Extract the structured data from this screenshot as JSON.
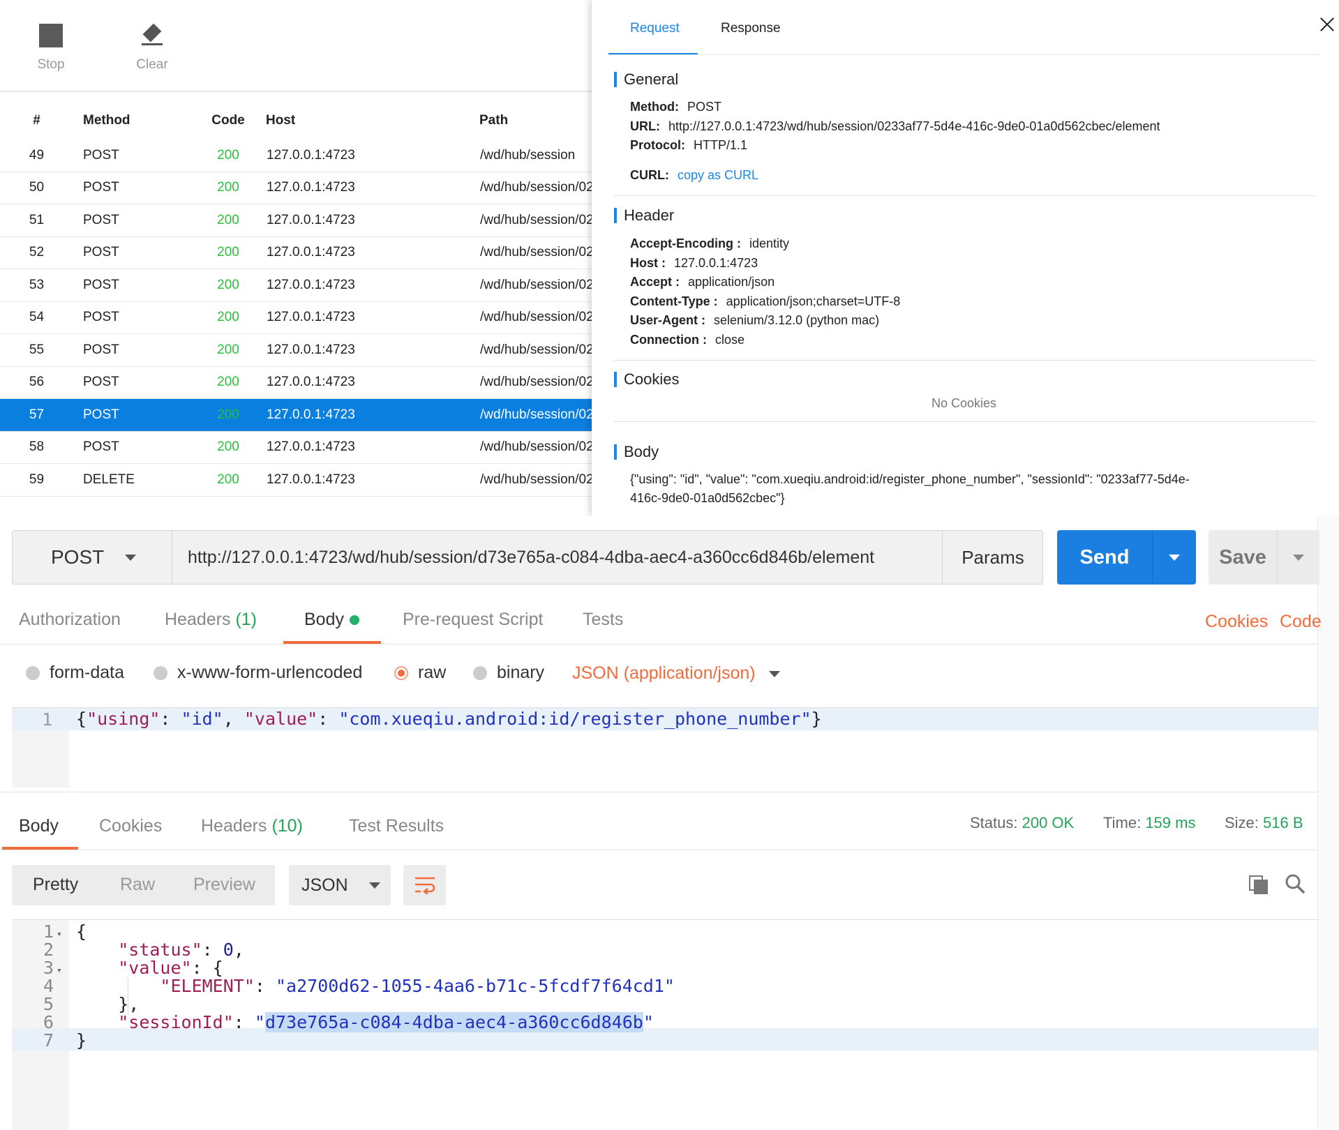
{
  "toolbar": {
    "stop_label": "Stop",
    "clear_label": "Clear"
  },
  "traffic": {
    "columns": [
      "#",
      "Method",
      "Code",
      "Host",
      "Path"
    ],
    "rows": [
      {
        "num": "49",
        "method": "POST",
        "code": "200",
        "host": "127.0.0.1:4723",
        "path": "/wd/hub/session"
      },
      {
        "num": "50",
        "method": "POST",
        "code": "200",
        "host": "127.0.0.1:4723",
        "path": "/wd/hub/session/02"
      },
      {
        "num": "51",
        "method": "POST",
        "code": "200",
        "host": "127.0.0.1:4723",
        "path": "/wd/hub/session/02"
      },
      {
        "num": "52",
        "method": "POST",
        "code": "200",
        "host": "127.0.0.1:4723",
        "path": "/wd/hub/session/02"
      },
      {
        "num": "53",
        "method": "POST",
        "code": "200",
        "host": "127.0.0.1:4723",
        "path": "/wd/hub/session/02"
      },
      {
        "num": "54",
        "method": "POST",
        "code": "200",
        "host": "127.0.0.1:4723",
        "path": "/wd/hub/session/02"
      },
      {
        "num": "55",
        "method": "POST",
        "code": "200",
        "host": "127.0.0.1:4723",
        "path": "/wd/hub/session/02"
      },
      {
        "num": "56",
        "method": "POST",
        "code": "200",
        "host": "127.0.0.1:4723",
        "path": "/wd/hub/session/02"
      },
      {
        "num": "57",
        "method": "POST",
        "code": "200",
        "host": "127.0.0.1:4723",
        "path": "/wd/hub/session/02"
      },
      {
        "num": "58",
        "method": "POST",
        "code": "200",
        "host": "127.0.0.1:4723",
        "path": "/wd/hub/session/02"
      },
      {
        "num": "59",
        "method": "DELETE",
        "code": "200",
        "host": "127.0.0.1:4723",
        "path": "/wd/hub/session/02"
      }
    ],
    "selected": "57"
  },
  "detail": {
    "tabs": {
      "request": "Request",
      "response": "Response"
    },
    "general": {
      "title": "General",
      "method_label": "Method:",
      "method": "POST",
      "url_label": "URL:",
      "url": "http://127.0.0.1:4723/wd/hub/session/0233af77-5d4e-416c-9de0-01a0d562cbec/element",
      "protocol_label": "Protocol:",
      "protocol": "HTTP/1.1",
      "curl_label": "CURL:",
      "curl_link": "copy as CURL"
    },
    "header": {
      "title": "Header",
      "items": [
        {
          "key": "Accept-Encoding :",
          "value": "identity"
        },
        {
          "key": "Host :",
          "value": "127.0.0.1:4723"
        },
        {
          "key": "Accept :",
          "value": "application/json"
        },
        {
          "key": "Content-Type :",
          "value": "application/json;charset=UTF-8"
        },
        {
          "key": "User-Agent :",
          "value": "selenium/3.12.0 (python mac)"
        },
        {
          "key": "Connection :",
          "value": "close"
        }
      ]
    },
    "cookies": {
      "title": "Cookies",
      "empty": "No Cookies"
    },
    "body": {
      "title": "Body",
      "line1": "{\"using\": \"id\", \"value\": \"com.xueqiu.android:id/register_phone_number\", \"sessionId\": \"0233af77-5d4e-",
      "line2": "416c-9de0-01a0d562cbec\"}"
    }
  },
  "postman": {
    "method": "POST",
    "url": "http://127.0.0.1:4723/wd/hub/session/d73e765a-c084-4dba-aec4-a360cc6d846b/element",
    "params_label": "Params",
    "send_label": "Send",
    "save_label": "Save",
    "request_tabs": {
      "authorization": "Authorization",
      "headers": "Headers",
      "headers_count": "(1)",
      "body": "Body",
      "prerequest": "Pre-request Script",
      "tests": "Tests"
    },
    "cookies_link": "Cookies",
    "code_link": "Code",
    "body_modes": {
      "form_data": "form-data",
      "urlencoded": "x-www-form-urlencoded",
      "raw": "raw",
      "binary": "binary"
    },
    "content_type": "JSON (application/json)",
    "request_body": {
      "line_number": "1",
      "p1": "{",
      "k1": "\"using\"",
      "p2": ": ",
      "v1": "\"id\"",
      "p3": ", ",
      "k2": "\"value\"",
      "p4": ": ",
      "v2": "\"com.xueqiu.android:id/register_phone_number\"",
      "p5": "}"
    },
    "response_tabs": {
      "body": "Body",
      "cookies": "Cookies",
      "headers": "Headers",
      "headers_count": "(10)",
      "test_results": "Test Results"
    },
    "status": {
      "status_label": "Status:",
      "status": "200 OK",
      "time_label": "Time:",
      "time": "159 ms",
      "size_label": "Size:",
      "size": "516 B"
    },
    "view_modes": {
      "pretty": "Pretty",
      "raw": "Raw",
      "preview": "Preview"
    },
    "format": "JSON",
    "response_lines": [
      "1",
      "2",
      "3",
      "4",
      "5",
      "6",
      "7"
    ],
    "response": {
      "open": "{",
      "status_key": "\"status\"",
      "status_colon": ": ",
      "status_val": "0",
      "comma": ",",
      "value_key": "\"value\"",
      "value_colon": ": {",
      "element_key": "\"ELEMENT\"",
      "element_colon": ": ",
      "element_val": "\"a2700d62-1055-4aa6-b71c-5fcdf7f64cd1\"",
      "inner_close": "},",
      "session_key": "\"sessionId\"",
      "session_colon": ": ",
      "quote": "\"",
      "session_val": "d73e765a-c084-4dba-aec4-a360cc6d846b",
      "close": "}"
    },
    "icons": {
      "copy": "copy-icon",
      "search": "search-icon",
      "wrap": "wrap-lines-icon"
    }
  }
}
